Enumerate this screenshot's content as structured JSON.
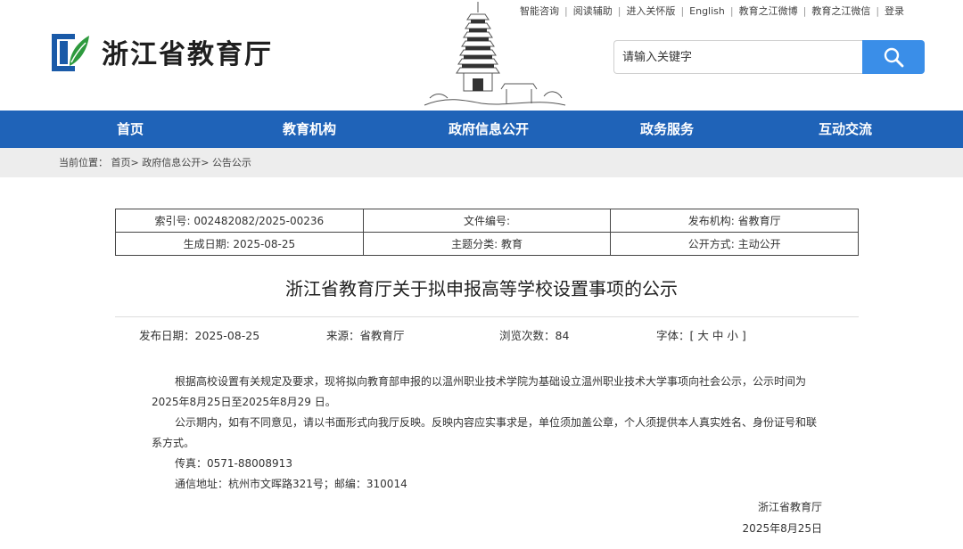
{
  "site": {
    "name": "浙江省教育厅"
  },
  "toplinks": [
    "智能咨询",
    "阅读辅助",
    "进入关怀版",
    "English",
    "教育之江微博",
    "教育之江微信",
    "登录"
  ],
  "search": {
    "placeholder": "请输入关键字"
  },
  "nav": [
    "首页",
    "教育机构",
    "政府信息公开",
    "政务服务",
    "互动交流"
  ],
  "breadcrumb": {
    "label": "当前位置：",
    "items": [
      "首页",
      "政府信息公开",
      "公告公示"
    ],
    "separator": ">"
  },
  "meta": {
    "index_no": "索引号: 002482082/2025-00236",
    "doc_no": "文件编号:",
    "publisher": "发布机构: 省教育厅",
    "created": "生成日期: 2025-08-25",
    "topic": "主题分类: 教育",
    "disclosure": "公开方式: 主动公开"
  },
  "article": {
    "title": "浙江省教育厅关于拟申报高等学校设置事项的公示",
    "publish_date": "发布日期：2025-08-25",
    "source": "来源：省教育厅",
    "views": "浏览次数：84",
    "font_label": "字体：[",
    "font_large": "大",
    "font_medium": "中",
    "font_small": "小",
    "font_close": "]",
    "paragraphs": [
      "根据高校设置有关规定及要求，现将拟向教育部申报的以温州职业技术学院为基础设立温州职业技术大学事项向社会公示，公示时间为2025年8月25日至2025年8月29 日。",
      "公示期内，如有不同意见，请以书面形式向我厅反映。反映内容应实事求是，单位须加盖公章，个人须提供本人真实姓名、身份证号和联系方式。"
    ],
    "fax": "传真：0571-88008913",
    "address": "通信地址：杭州市文晖路321号；邮编：310014",
    "sign_org": "浙江省教育厅",
    "sign_date": "2025年8月25日"
  },
  "colors": {
    "nav_bg": "#1f63b8",
    "search_button": "#3a8ee8",
    "logo_blue": "#1a5aa8",
    "logo_green": "#2e9a3e",
    "breadcrumb_bg": "#ededed"
  }
}
